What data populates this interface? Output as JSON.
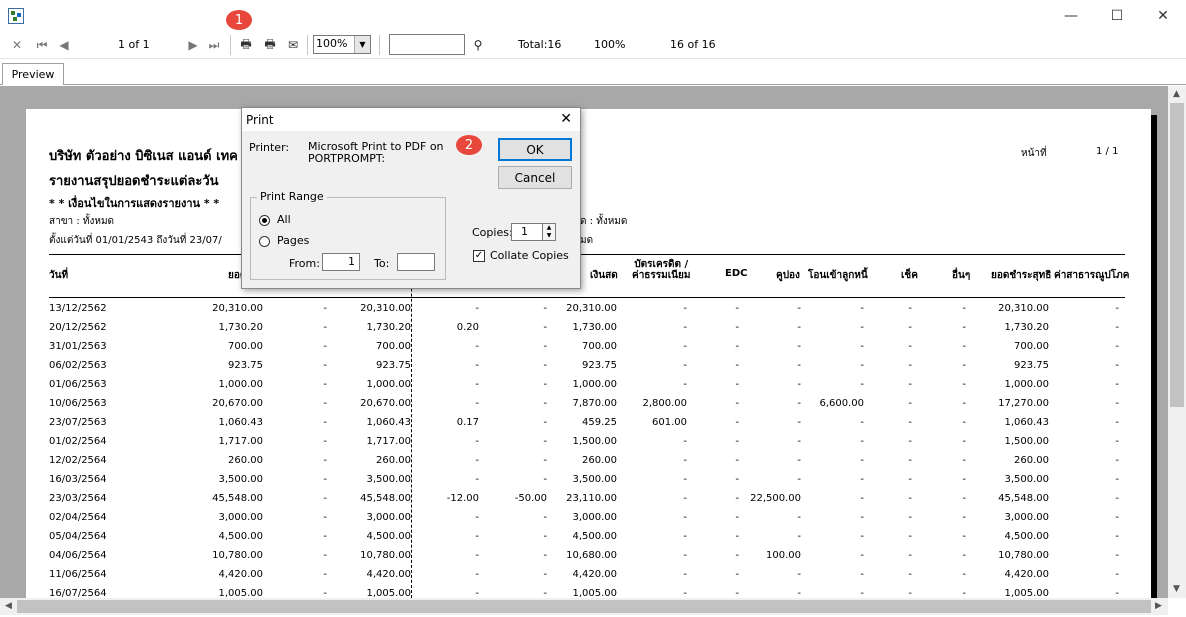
{
  "toolbar": {
    "page_indicator": "1 of 1",
    "zoom": "100%",
    "total": "Total:16",
    "percent": "100%",
    "count": "16 of 16"
  },
  "tabs": [
    "Preview"
  ],
  "report": {
    "company": "บริษัท ตัวอย่าง บิซิเนส แอนด์ เทค",
    "title": "รายงานสรุปยอดชำระแต่ละวัน",
    "conditions": "* * เงื่อนไขในการแสดงรายงาน * *",
    "branch": "สาขา : ทั้งหมด",
    "date_from": "ตั้งแต่วันที่  01/01/2543   ถึงวันที่   23/07/",
    "right_cond1": "ด : ทั้งหมด",
    "right_cond2": "มด",
    "page_label": "หน้าที่",
    "page_value": "1  /  1",
    "headers": {
      "date": "วันที่",
      "amount": "ยอด",
      "cash": "เงินสด",
      "credit_card": "บัตรเครดิต /\nค่าธรรมเนียม",
      "edc": "EDC",
      "coupon": "คูปอง",
      "transfer": "โอนเข้าลูกหนี้",
      "cheque": "เช็ค",
      "other": "อื่นๆ",
      "net": "ยอดชำระสุทธิ",
      "utilities": "ค่าสาธารณูปโภค"
    },
    "rows": [
      [
        "13/12/2562",
        "20,310.00",
        "-",
        "20,310.00",
        "-",
        "-",
        "20,310.00",
        "-",
        "-",
        "-",
        "-",
        "-",
        "-",
        "20,310.00",
        "-"
      ],
      [
        "20/12/2562",
        "1,730.20",
        "-",
        "1,730.20",
        "0.20",
        "-",
        "1,730.00",
        "-",
        "-",
        "-",
        "-",
        "-",
        "-",
        "1,730.20",
        "-"
      ],
      [
        "31/01/2563",
        "700.00",
        "-",
        "700.00",
        "-",
        "-",
        "700.00",
        "-",
        "-",
        "-",
        "-",
        "-",
        "-",
        "700.00",
        "-"
      ],
      [
        "06/02/2563",
        "923.75",
        "-",
        "923.75",
        "-",
        "-",
        "923.75",
        "-",
        "-",
        "-",
        "-",
        "-",
        "-",
        "923.75",
        "-"
      ],
      [
        "01/06/2563",
        "1,000.00",
        "-",
        "1,000.00",
        "-",
        "-",
        "1,000.00",
        "-",
        "-",
        "-",
        "-",
        "-",
        "-",
        "1,000.00",
        "-"
      ],
      [
        "10/06/2563",
        "20,670.00",
        "-",
        "20,670.00",
        "-",
        "-",
        "7,870.00",
        "2,800.00",
        "-",
        "-",
        "6,600.00",
        "-",
        "-",
        "17,270.00",
        "-"
      ],
      [
        "23/07/2563",
        "1,060.43",
        "-",
        "1,060.43",
        "0.17",
        "-",
        "459.25",
        "601.00",
        "-",
        "-",
        "-",
        "-",
        "-",
        "1,060.43",
        "-"
      ],
      [
        "01/02/2564",
        "1,717.00",
        "-",
        "1,717.00",
        "-",
        "-",
        "1,500.00",
        "-",
        "-",
        "-",
        "-",
        "-",
        "-",
        "1,500.00",
        "-"
      ],
      [
        "12/02/2564",
        "260.00",
        "-",
        "260.00",
        "-",
        "-",
        "260.00",
        "-",
        "-",
        "-",
        "-",
        "-",
        "-",
        "260.00",
        "-"
      ],
      [
        "16/03/2564",
        "3,500.00",
        "-",
        "3,500.00",
        "-",
        "-",
        "3,500.00",
        "-",
        "-",
        "-",
        "-",
        "-",
        "-",
        "3,500.00",
        "-"
      ],
      [
        "23/03/2564",
        "45,548.00",
        "-",
        "45,548.00",
        "-12.00",
        "-50.00",
        "23,110.00",
        "-",
        "-",
        "22,500.00",
        "-",
        "-",
        "-",
        "45,548.00",
        "-"
      ],
      [
        "02/04/2564",
        "3,000.00",
        "-",
        "3,000.00",
        "-",
        "-",
        "3,000.00",
        "-",
        "-",
        "-",
        "-",
        "-",
        "-",
        "3,000.00",
        "-"
      ],
      [
        "05/04/2564",
        "4,500.00",
        "-",
        "4,500.00",
        "-",
        "-",
        "4,500.00",
        "-",
        "-",
        "-",
        "-",
        "-",
        "-",
        "4,500.00",
        "-"
      ],
      [
        "04/06/2564",
        "10,780.00",
        "-",
        "10,780.00",
        "-",
        "-",
        "10,680.00",
        "-",
        "-",
        "100.00",
        "-",
        "-",
        "-",
        "10,780.00",
        "-"
      ],
      [
        "11/06/2564",
        "4,420.00",
        "-",
        "4,420.00",
        "-",
        "-",
        "4,420.00",
        "-",
        "-",
        "-",
        "-",
        "-",
        "-",
        "4,420.00",
        "-"
      ],
      [
        "16/07/2564",
        "1,005.00",
        "-",
        "1,005.00",
        "-",
        "-",
        "1,005.00",
        "-",
        "-",
        "-",
        "-",
        "-",
        "-",
        "1,005.00",
        "-"
      ]
    ]
  },
  "dialog": {
    "title": "Print",
    "printer_label": "Printer:",
    "printer_name": "Microsoft Print to PDF on PORTPROMPT:",
    "ok": "OK",
    "cancel": "Cancel",
    "range_label": "Print Range",
    "all": "All",
    "pages": "Pages",
    "from_label": "From:",
    "from_value": "1",
    "to_label": "To:",
    "to_value": "",
    "copies_label": "Copies:",
    "copies_value": "1",
    "collate": "Collate Copies"
  },
  "badges": [
    "1",
    "2"
  ],
  "colors": {
    "badge": "#e8473c",
    "default_button_border": "#0078d7",
    "viewer_bg": "#a8a8a8"
  }
}
